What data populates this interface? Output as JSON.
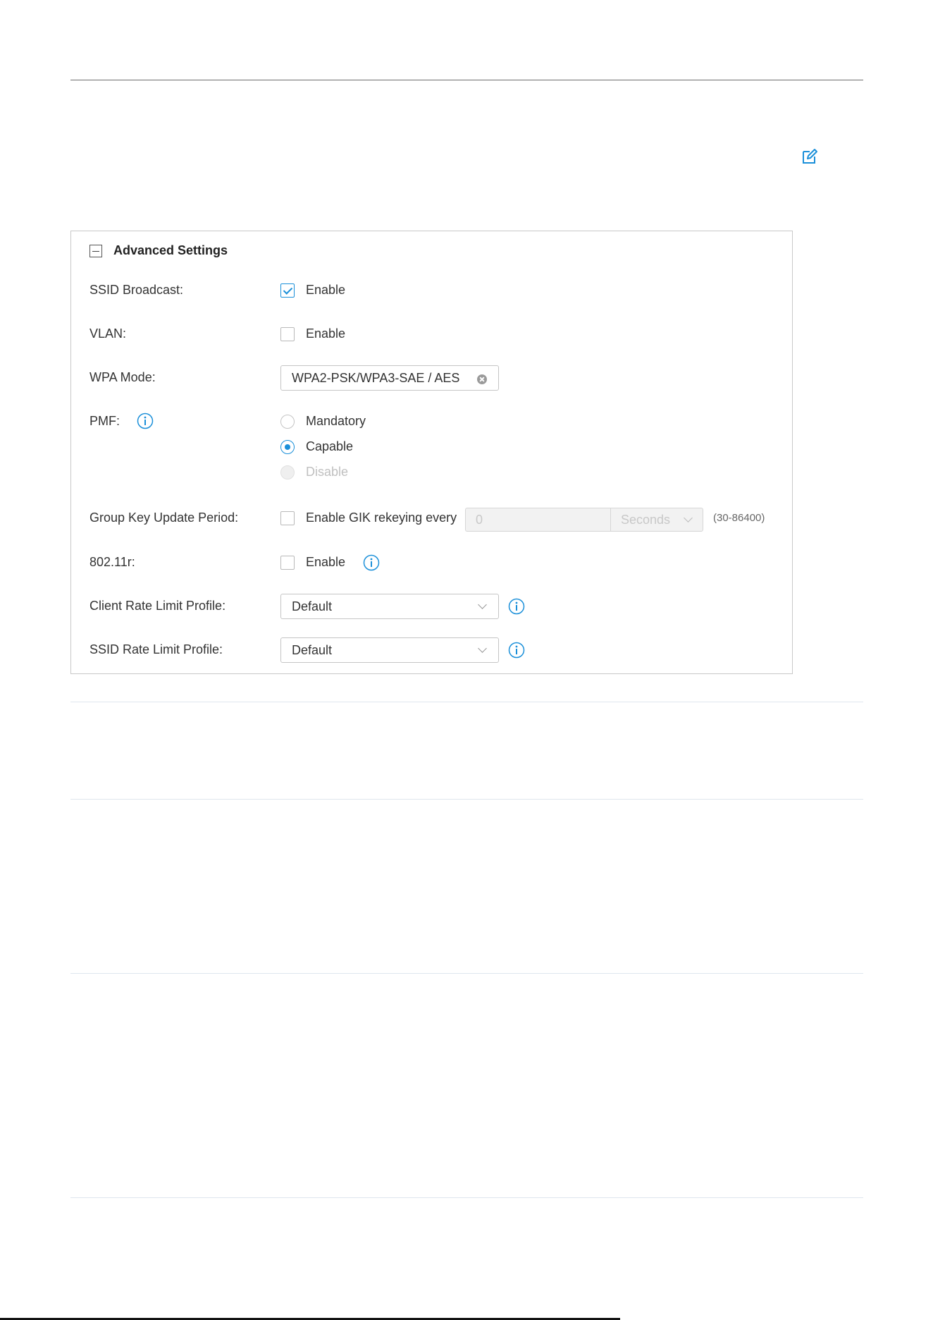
{
  "advanced_settings": {
    "title": "Advanced Settings",
    "ssid_broadcast": {
      "label": "SSID Broadcast:",
      "checkbox_label": "Enable",
      "checked": true
    },
    "vlan": {
      "label": "VLAN:",
      "checkbox_label": "Enable",
      "checked": false
    },
    "wpa_mode": {
      "label": "WPA Mode:",
      "value": "WPA2-PSK/WPA3-SAE / AES"
    },
    "pmf": {
      "label": "PMF:",
      "options": [
        {
          "label": "Mandatory",
          "selected": false,
          "disabled": false
        },
        {
          "label": "Capable",
          "selected": true,
          "disabled": false
        },
        {
          "label": "Disable",
          "selected": false,
          "disabled": true
        }
      ]
    },
    "group_key_update_period": {
      "label": "Group Key Update Period:",
      "checkbox_label": "Enable GIK rekeying every",
      "checked": false,
      "value": "0",
      "unit": "Seconds",
      "range": "(30-86400)"
    },
    "dot11r": {
      "label": "802.11r:",
      "checkbox_label": "Enable",
      "checked": false
    },
    "client_rate_limit_profile": {
      "label": "Client Rate Limit Profile:",
      "value": "Default"
    },
    "ssid_rate_limit_profile": {
      "label": "SSID Rate Limit Profile:",
      "value": "Default"
    }
  },
  "icons": {
    "edit": "edit-icon",
    "info": "info-icon",
    "collapse": "collapse-icon",
    "clear": "clear-icon"
  },
  "colors": {
    "accent": "#1a8fd9",
    "border": "#c8c8c8",
    "text": "#333333",
    "disabled_text": "#c0c0c0"
  }
}
